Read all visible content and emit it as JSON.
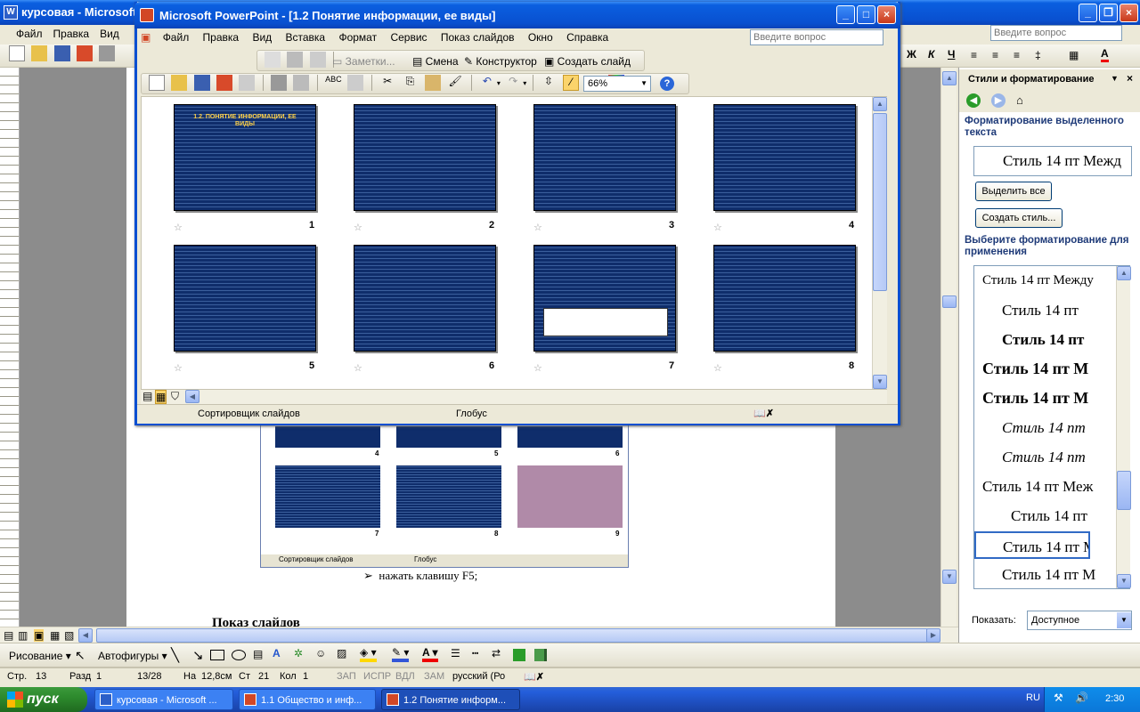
{
  "word": {
    "title": "курсовая - Microsoft",
    "menu": [
      "Файл",
      "Правка",
      "Вид"
    ],
    "question_placeholder": "Введите вопрос",
    "doc_text": "нажать клавишу F5;",
    "doc_heading": "Показ слайдов",
    "inner_status": [
      "Сортировщик слайдов",
      "Глобус"
    ],
    "inner_nums": [
      "4",
      "5",
      "6",
      "7",
      "8",
      "9"
    ],
    "status": [
      "Стр.",
      "13",
      "Разд",
      "1",
      "13/28",
      "На",
      "12,8см",
      "Ст",
      "21",
      "Кол",
      "1",
      "ЗАП",
      "ИСПР",
      "ВДЛ",
      "ЗАМ",
      "русский (Ро"
    ],
    "draw": {
      "label": "Рисование",
      "autoshapes": "Автофигуры"
    }
  },
  "ppt": {
    "title": "Microsoft PowerPoint - [1.2 Понятие информации, ее виды]",
    "menu": [
      "Файл",
      "Правка",
      "Вид",
      "Вставка",
      "Формат",
      "Сервис",
      "Показ слайдов",
      "Окно",
      "Справка"
    ],
    "question_placeholder": "Введите вопрос",
    "toolbar2": {
      "notes": "Заметки...",
      "change": "Смена",
      "designer": "Конструктор",
      "new_slide": "Создать слайд"
    },
    "zoom": "66%",
    "slide_title": "1.2. ПОНЯТИЕ ИНФОРМАЦИИ, ЕЕ ВИДЫ",
    "slides": [
      "1",
      "2",
      "3",
      "4",
      "5",
      "6",
      "7",
      "8"
    ],
    "status": {
      "view": "Сортировщик слайдов",
      "design": "Глобус"
    }
  },
  "pane": {
    "title": "Стили и форматирование",
    "selected_label": "Форматирование выделенного текста",
    "selected_value": "Стиль 14 пт Межд",
    "select_all": "Выделить все",
    "new_style": "Создать стиль...",
    "apply_label": "Выберите форматирование для применения",
    "styles": [
      "Стиль 14 пт Между",
      "Стиль 14 пт",
      "Стиль 14 пт",
      "Стиль 14 пт М",
      "Стиль 14 пт М",
      "Стиль 14 пт",
      "Стиль 14 пт",
      "Стиль 14 пт Меж",
      "Стиль 14 пт",
      "Стиль 14 пт М",
      "Стиль 14 пт М"
    ],
    "show_label": "Показать:",
    "show_value": "Доступное"
  },
  "taskbar": {
    "start": "пуск",
    "tasks": [
      "курсовая - Microsoft ...",
      "1.1 Общество и инф...",
      "1.2 Понятие информ..."
    ],
    "lang": "RU",
    "time": "2:30"
  },
  "colors": {
    "xp_blue": "#0a5fe0",
    "slide_blue": "#0f2d6b",
    "start_green": "#3c9a3c"
  }
}
